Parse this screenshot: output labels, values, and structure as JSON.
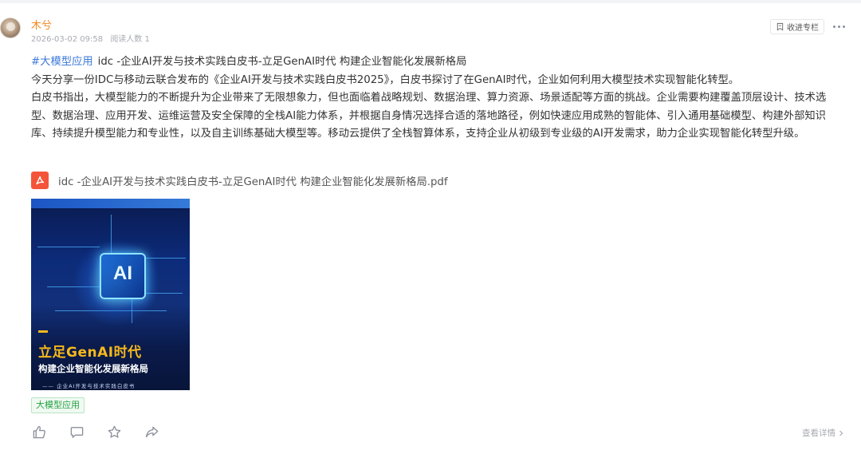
{
  "author": {
    "name": "木兮",
    "datetime": "2026-03-02 09:58",
    "read_count_label": "阅读人数 1"
  },
  "header_actions": {
    "collect_label": "收进专栏",
    "collect_icon": "bookmark-icon",
    "more_icon": "more-dots-icon"
  },
  "post": {
    "hashtag": "#大模型应用",
    "title": "idc -企业AI开发与技术实践白皮书-立足GenAI时代 构建企业智能化发展新格局",
    "paragraphs": [
      "今天分享一份IDC与移动云联合发布的《企业AI开发与技术实践白皮书2025》，白皮书探讨了在GenAI时代，企业如何利用大模型技术实现智能化转型。",
      "白皮书指出，大模型能力的不断提升为企业带来了无限想象力，但也面临着战略规划、数据治理、算力资源、场景适配等方面的挑战。企业需要构建覆盖顶层设计、技术选型、数据治理、应用开发、运维运营及安全保障的全栈AI能力体系，并根据自身情况选择合适的落地路径，例如快速应用成熟的智能体、引入通用基础模型、构建外部知识库、持续提升模型能力和专业性，以及自主训练基础大模型等。移动云提供了全栈智算体系，支持企业从初级到专业级的AI开发需求，助力企业实现智能化转型升级。"
    ]
  },
  "attachment": {
    "file_name": "idc -企业AI开发与技术实践白皮书-立足GenAI时代 构建企业智能化发展新格局.pdf",
    "icon": "pdf-icon",
    "icon_color": "#f4553a"
  },
  "cover": {
    "chip_text": "AI",
    "title": "立足GenAI时代",
    "subtitle": "构建企业智能化发展新格局",
    "footer": "—— 企业AI开发与技术实践白皮书"
  },
  "topic_tag": "大模型应用",
  "footer": {
    "actions": [
      "like-icon",
      "comment-icon",
      "favorite-star-icon",
      "share-icon"
    ],
    "detail_label": "查看详情"
  },
  "colors": {
    "author_name": "#f08a24",
    "hashtag": "#3e7ad9",
    "tag_text": "#25a244",
    "cover_title": "#f6b81c"
  }
}
